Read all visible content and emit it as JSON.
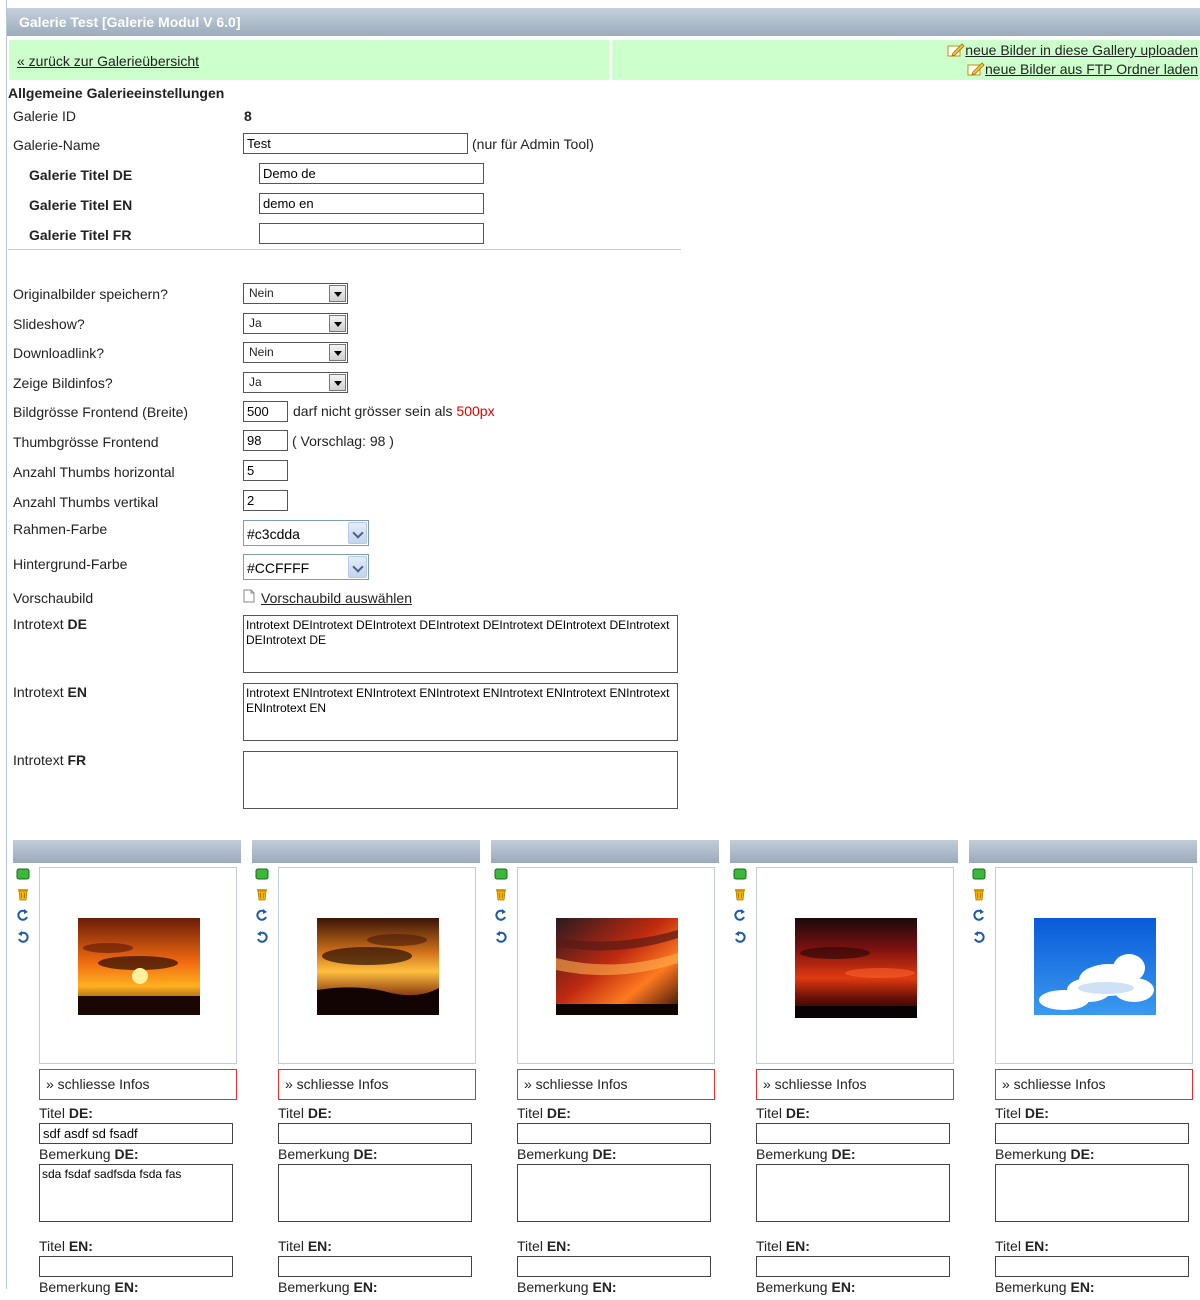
{
  "window": {
    "title": "Galerie Test [Galerie Modul V 6.0]"
  },
  "nav": {
    "back_link": "« zurück zur Galerieübersicht",
    "upload_link": "neue Bilder in diese Gallery uploaden",
    "ftp_link": "neue Bilder aus FTP Ordner laden"
  },
  "settings": {
    "heading": "Allgemeine Galerieeinstellungen",
    "gallery_id_label": "Galerie ID",
    "gallery_id_value": "8",
    "gallery_name_label": "Galerie-Name",
    "gallery_name_value": "Test",
    "gallery_name_note": "(nur für Admin Tool)",
    "title_de_label": "Galerie Titel DE",
    "title_de_value": "Demo de",
    "title_en_label": "Galerie Titel EN",
    "title_en_value": "demo en",
    "title_fr_label": "Galerie Titel FR",
    "title_fr_value": "",
    "save_originals_label": "Originalbilder speichern?",
    "save_originals_value": "Nein",
    "slideshow_label": "Slideshow?",
    "slideshow_value": "Ja",
    "download_label": "Downloadlink?",
    "download_value": "Nein",
    "show_info_label": "Zeige Bildinfos?",
    "show_info_value": "Ja",
    "image_size_label": "Bildgrösse Frontend (Breite)",
    "image_size_value": "500",
    "image_size_note": "darf nicht grösser sein als",
    "image_size_max": "500px",
    "thumb_size_label": "Thumbgrösse Frontend",
    "thumb_size_value": "98",
    "thumb_size_note": "( Vorschlag: 98 )",
    "thumbs_h_label": "Anzahl Thumbs horizontal",
    "thumbs_h_value": "5",
    "thumbs_v_label": "Anzahl Thumbs vertikal",
    "thumbs_v_value": "2",
    "frame_color_label": "Rahmen-Farbe",
    "frame_color_value": "#c3cdda",
    "bg_color_label": "Hintergrund-Farbe",
    "bg_color_value": "#CCFFFF",
    "preview_label": "Vorschaubild",
    "preview_link": "Vorschaubild auswählen",
    "intro_label": "Introtext",
    "intro_de_lang": "DE",
    "intro_de_value": "Introtext DEIntrotext DEIntrotext DEIntrotext DEIntrotext DEIntrotext DEIntrotext DEIntrotext DE",
    "intro_en_lang": "EN",
    "intro_en_value": "Introtext ENIntrotext ENIntrotext ENIntrotext ENIntrotext ENIntrotext ENIntrotext ENIntrotext EN",
    "intro_fr_lang": "FR",
    "intro_fr_value": ""
  },
  "thumbs": {
    "info_button": "» schliesse Infos",
    "title_word": "Titel",
    "remark_word": "Bemerkung",
    "de": "DE:",
    "en": "EN:",
    "items": [
      {
        "title_de": "sdf asdf sd fsadf",
        "remark_de": "sda fsdaf sadfsda fsda fas",
        "title_en": ""
      },
      {
        "title_de": "",
        "remark_de": "",
        "title_en": ""
      },
      {
        "title_de": "",
        "remark_de": "",
        "title_en": ""
      },
      {
        "title_de": "",
        "remark_de": "",
        "title_en": ""
      },
      {
        "title_de": "",
        "remark_de": "",
        "title_en": ""
      }
    ]
  },
  "colors": {
    "nav_bg": "#ccffcc",
    "accent_red": "#e00000",
    "frame": "#c3cdda"
  }
}
